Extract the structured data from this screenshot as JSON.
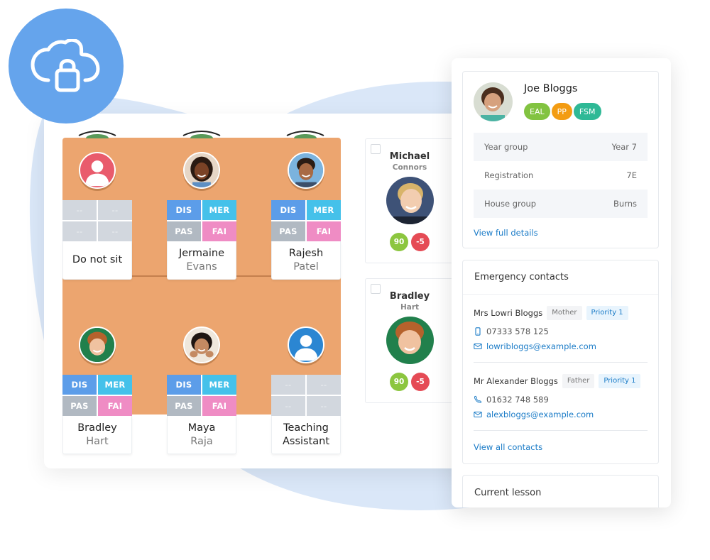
{
  "badge": {
    "icon": "cloud-lock-icon"
  },
  "seating_plan": {
    "seats": [
      {
        "id": "do-not-sit",
        "avatar": "placeholder-red",
        "first": "Do not sit",
        "last": "",
        "cells": [
          "--",
          "--",
          "--",
          "--"
        ],
        "empty": true
      },
      {
        "id": "jermaine-evans",
        "avatar": "photo",
        "first": "Jermaine",
        "last": "Evans",
        "cells": [
          "DIS",
          "MER",
          "PAS",
          "FAI"
        ],
        "empty": false
      },
      {
        "id": "rajesh-patel",
        "avatar": "photo",
        "first": "Rajesh",
        "last": "Patel",
        "cells": [
          "DIS",
          "MER",
          "PAS",
          "FAI"
        ],
        "empty": false
      },
      {
        "id": "bradley-hart",
        "avatar": "photo",
        "first": "Bradley",
        "last": "Hart",
        "cells": [
          "DIS",
          "MER",
          "PAS",
          "FAI"
        ],
        "empty": false
      },
      {
        "id": "maya-raja",
        "avatar": "photo",
        "first": "Maya",
        "last": "Raja",
        "cells": [
          "DIS",
          "MER",
          "PAS",
          "FAI"
        ],
        "empty": false
      },
      {
        "id": "teaching-assistant",
        "avatar": "placeholder-blue",
        "first": "Teaching",
        "last": "Assistant",
        "cells": [
          "--",
          "--",
          "--",
          "--"
        ],
        "empty": true
      }
    ]
  },
  "student_list": [
    {
      "first": "Michael",
      "last": "Connors",
      "positive": "90",
      "negative": "-5",
      "checked": false
    },
    {
      "first": "Bradley",
      "last": "Hart",
      "positive": "90",
      "negative": "-5",
      "checked": false
    }
  ],
  "profile": {
    "name": "Joe Bloggs",
    "tags": [
      {
        "label": "EAL",
        "color": "#82c341"
      },
      {
        "label": "PP",
        "color": "#f39c12"
      },
      {
        "label": "FSM",
        "color": "#2fb996"
      }
    ],
    "info": [
      {
        "label": "Year group",
        "value": "Year 7"
      },
      {
        "label": "Registration",
        "value": "7E"
      },
      {
        "label": "House group",
        "value": "Burns"
      }
    ],
    "link": "View full details"
  },
  "emergency_contacts": {
    "title": "Emergency contacts",
    "contacts": [
      {
        "name": "Mrs Lowri Bloggs",
        "relation": "Mother",
        "priority": "Priority 1",
        "phone": "07333 578 125",
        "phone_icon": "mobile-icon",
        "email": "lowribloggs@example.com"
      },
      {
        "name": "Mr Alexander Bloggs",
        "relation": "Father",
        "priority": "Priority 1",
        "phone": "01632 748 589",
        "phone_icon": "phone-icon",
        "email": "alexbloggs@example.com"
      }
    ],
    "link": "View all contacts"
  },
  "current_lesson": {
    "title": "Current lesson"
  },
  "colors": {
    "badge": "#65a4ec",
    "floor": "#eca56f",
    "link": "#1a7bc7",
    "dis": "#5c9de9",
    "mer": "#45c1ea",
    "pas": "#b1b9c2",
    "fai": "#ef8cc4",
    "positive": "#8cc63f",
    "negative": "#e54b55"
  }
}
